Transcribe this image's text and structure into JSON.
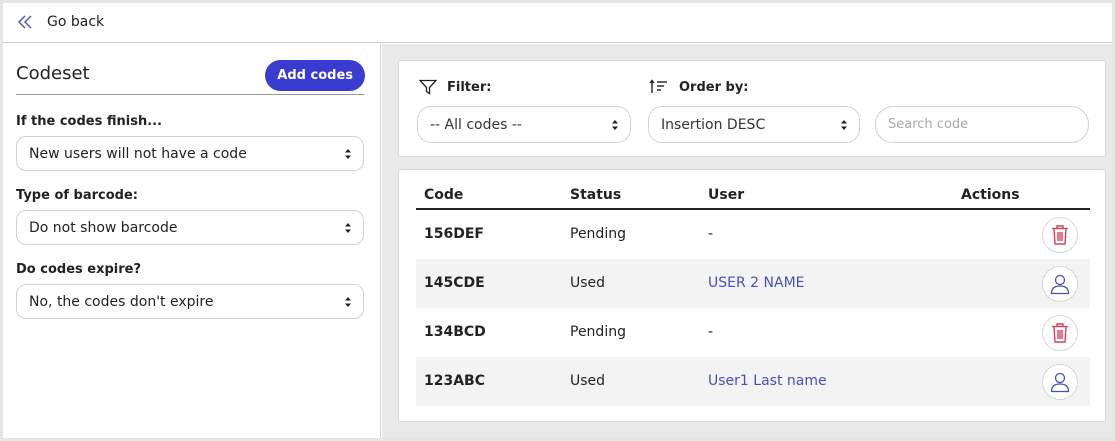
{
  "topbar": {
    "back_label": "Go back",
    "back_icon": "double-chevron-left-icon"
  },
  "left": {
    "title": "Codeset",
    "add_button": "Add codes",
    "fields": [
      {
        "label": "If the codes finish...",
        "value": "New users will not have a code"
      },
      {
        "label": "Type of barcode:",
        "value": "Do not show barcode"
      },
      {
        "label": "Do codes expire?",
        "value": "No, the codes don't expire"
      }
    ]
  },
  "filters": {
    "filter_label": "Filter:",
    "filter_value": "-- All codes --",
    "order_label": "Order by:",
    "order_value": "Insertion DESC",
    "search_placeholder": "Search code"
  },
  "table": {
    "columns": [
      "Code",
      "Status",
      "User",
      "Actions"
    ],
    "rows": [
      {
        "code": "156DEF",
        "status": "Pending",
        "user": "-",
        "action": "trash-icon"
      },
      {
        "code": "145CDE",
        "status": "Used",
        "user": "USER 2 NAME",
        "action": "user-icon"
      },
      {
        "code": "134BCD",
        "status": "Pending",
        "user": "-",
        "action": "trash-icon"
      },
      {
        "code": "123ABC",
        "status": "Used",
        "user": "User1 Last name",
        "action": "user-icon"
      }
    ]
  },
  "colors": {
    "accent": "#3a3ccf",
    "link": "#4a4fb8",
    "danger": "#d9415b",
    "row_alt": "#f3f3f3",
    "panel_bg": "#e9e9e9"
  }
}
